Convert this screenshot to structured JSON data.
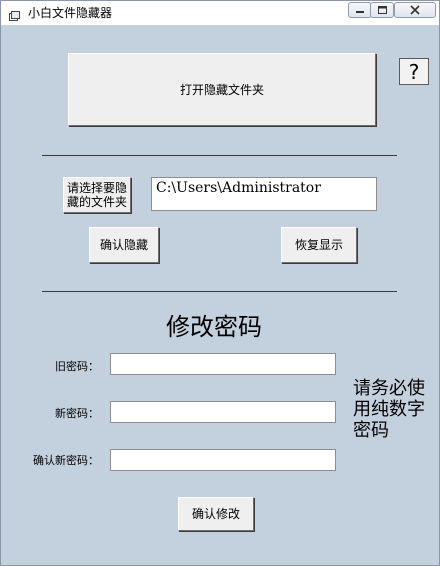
{
  "window": {
    "title": "小白文件隐藏器"
  },
  "help": {
    "label": "?"
  },
  "actions": {
    "open_hidden_folder": "打开隐藏文件夹",
    "choose_folder": "请选择要隐藏的文件夹",
    "confirm_hide": "确认隐藏",
    "restore_display": "恢复显示"
  },
  "path_field": {
    "value": "C:\\Users\\Administrator"
  },
  "password_section": {
    "heading": "修改密码",
    "old_label": "旧密码：",
    "new_label": "新密码：",
    "confirm_label": "确认新密码：",
    "notice": "请务必使用纯数字密码",
    "confirm_button": "确认修改"
  }
}
